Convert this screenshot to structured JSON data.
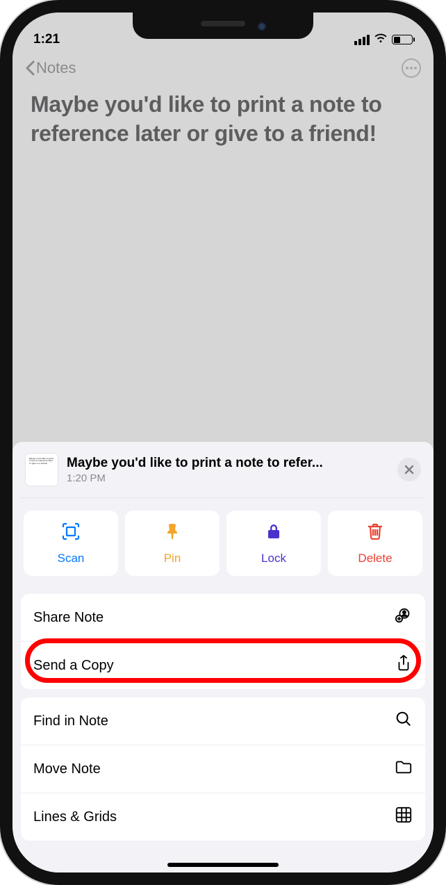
{
  "status": {
    "time": "1:21"
  },
  "nav": {
    "back_label": "Notes"
  },
  "note": {
    "title": "Maybe you'd like to print a note to reference later or give to a friend!"
  },
  "sheet": {
    "header": {
      "title": "Maybe you'd like to print a note to refer...",
      "timestamp": "1:20 PM",
      "thumb_text": "Maybe you'd like to print a note to reference later or give to a friend!"
    },
    "quick_actions": {
      "scan": "Scan",
      "pin": "Pin",
      "lock": "Lock",
      "delete": "Delete"
    },
    "menu": {
      "share_note": "Share Note",
      "send_copy": "Send a Copy",
      "find_in_note": "Find in Note",
      "move_note": "Move Note",
      "lines_grids": "Lines & Grids"
    }
  }
}
